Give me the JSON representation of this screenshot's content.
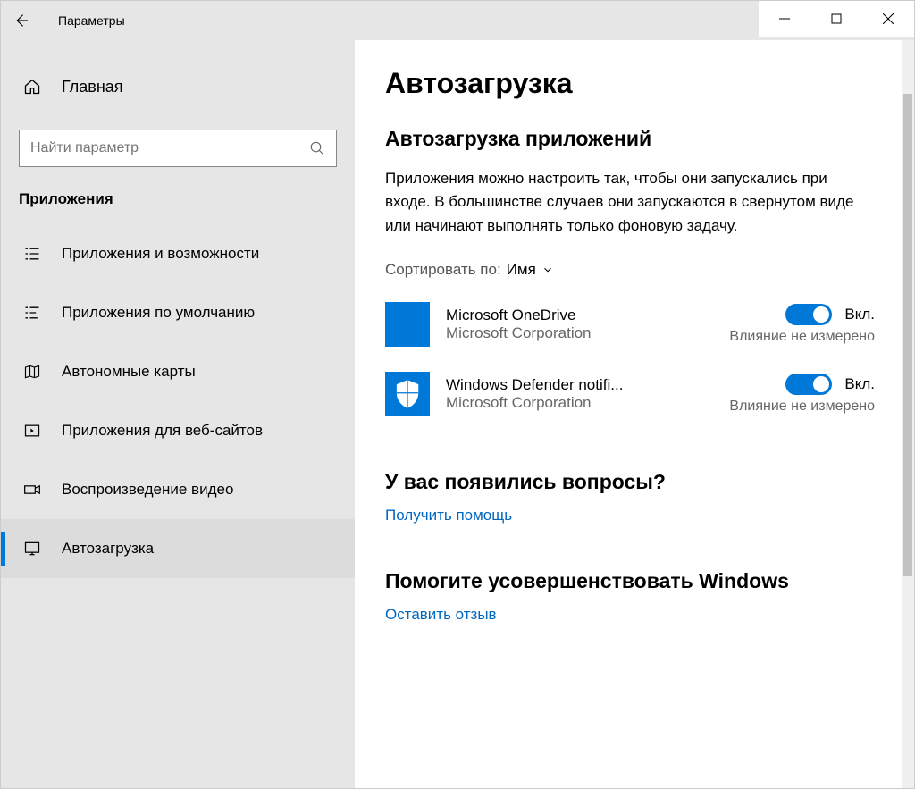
{
  "titlebar": {
    "title": "Параметры"
  },
  "sidebar": {
    "home": "Главная",
    "search_placeholder": "Найти параметр",
    "section": "Приложения",
    "items": [
      {
        "label": "Приложения и возможности"
      },
      {
        "label": "Приложения по умолчанию"
      },
      {
        "label": "Автономные карты"
      },
      {
        "label": "Приложения для веб-сайтов"
      },
      {
        "label": "Воспроизведение видео"
      },
      {
        "label": "Автозагрузка"
      }
    ]
  },
  "content": {
    "title": "Автозагрузка",
    "subheading": "Автозагрузка приложений",
    "description": "Приложения можно настроить так, чтобы они запускались при входе. В большинстве случаев они запускаются в свернутом виде или начинают выполнять только фоновую задачу.",
    "sort_label": "Сортировать по:",
    "sort_value": "Имя",
    "toggle_on": "Вкл.",
    "apps": [
      {
        "name": "Microsoft OneDrive",
        "publisher": "Microsoft Corporation",
        "impact": "Влияние не измерено"
      },
      {
        "name": "Windows Defender notifi...",
        "publisher": "Microsoft Corporation",
        "impact": "Влияние не измерено"
      }
    ],
    "help": {
      "heading": "У вас появились вопросы?",
      "link": "Получить помощь"
    },
    "feedback": {
      "heading": "Помогите усовершенствовать Windows",
      "link": "Оставить отзыв"
    }
  }
}
